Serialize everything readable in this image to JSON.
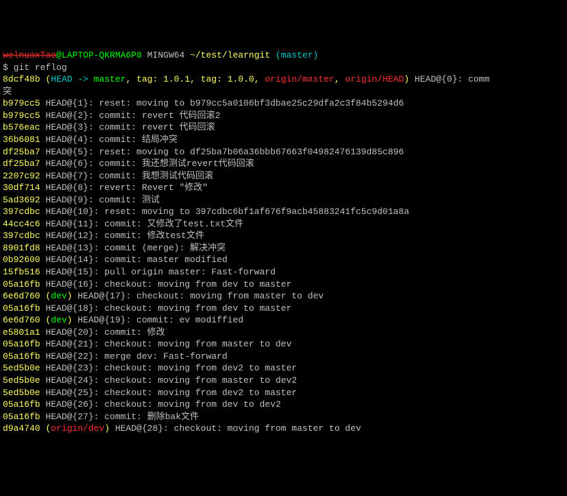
{
  "prompt": {
    "user_redacted": "welnuaxTao",
    "host": "@LAPTOP-QKRMA6P8",
    "shell": " MINGW64",
    "path": " ~/test/learngit",
    "branch": " (master)"
  },
  "command": "$ git reflog",
  "head_line": {
    "hash": "8dcf48b",
    "open": " (",
    "head": "HEAD -> ",
    "master": "master",
    "s1": ", ",
    "tag1": "tag: 1.0.1",
    "s2": ", ",
    "tag2": "tag: 1.0.0",
    "s3": ", ",
    "om": "origin/master",
    "s4": ", ",
    "oh": "origin/HEAD",
    "close": ")",
    "tail": " HEAD@{0}: comm"
  },
  "head_wrap": "突",
  "entries": [
    {
      "hash": "b979cc5",
      "ref": "",
      "text": " HEAD@{1}: reset: moving to b979cc5a0106bf3dbae25c29dfa2c3f84b5294d6"
    },
    {
      "hash": "b979cc5",
      "ref": "",
      "text": " HEAD@{2}: commit: revert 代码回滚2"
    },
    {
      "hash": "b576eac",
      "ref": "",
      "text": " HEAD@{3}: commit: revert 代码回滚"
    },
    {
      "hash": "36b6081",
      "ref": "",
      "text": " HEAD@{4}: commit: 结局冲突"
    },
    {
      "hash": "df25ba7",
      "ref": "",
      "text": " HEAD@{5}: reset: moving to df25ba7b06a36bbb67663f04982476139d85c896"
    },
    {
      "hash": "df25ba7",
      "ref": "",
      "text": " HEAD@{6}: commit: 我还想测试revert代码回滚"
    },
    {
      "hash": "2207c92",
      "ref": "",
      "text": " HEAD@{7}: commit: 我想测试代码回滚"
    },
    {
      "hash": "30df714",
      "ref": "",
      "text": " HEAD@{8}: revert: Revert \"修改\""
    },
    {
      "hash": "5ad3692",
      "ref": "",
      "text": " HEAD@{9}: commit: 测试"
    },
    {
      "hash": "397cdbc",
      "ref": "",
      "text": " HEAD@{10}: reset: moving to 397cdbc6bf1af676f9acb45883241fc5c9d01a8a"
    },
    {
      "hash": "44cc4c6",
      "ref": "",
      "text": " HEAD@{11}: commit: 又修改了test.txt文件"
    },
    {
      "hash": "397cdbc",
      "ref": "",
      "text": " HEAD@{12}: commit: 修改test文件"
    },
    {
      "hash": "8901fd8",
      "ref": "",
      "text": " HEAD@{13}: commit (merge): 解决冲突"
    },
    {
      "hash": "0b92600",
      "ref": "",
      "text": " HEAD@{14}: commit: master modified"
    },
    {
      "hash": "15fb516",
      "ref": "",
      "text": " HEAD@{15}: pull origin master: Fast-forward"
    },
    {
      "hash": "05a16fb",
      "ref": "",
      "text": " HEAD@{16}: checkout: moving from dev to master"
    },
    {
      "hash": "6e6d760",
      "ref": "dev",
      "text": " HEAD@{17}: checkout: moving from master to dev"
    },
    {
      "hash": "05a16fb",
      "ref": "",
      "text": " HEAD@{18}: checkout: moving from dev to master"
    },
    {
      "hash": "6e6d760",
      "ref": "dev",
      "text": " HEAD@{19}: commit: ev modiffied"
    },
    {
      "hash": "e5801a1",
      "ref": "",
      "text": " HEAD@{20}: commit: 修改"
    },
    {
      "hash": "05a16fb",
      "ref": "",
      "text": " HEAD@{21}: checkout: moving from master to dev"
    },
    {
      "hash": "05a16fb",
      "ref": "",
      "text": " HEAD@{22}: merge dev: Fast-forward"
    },
    {
      "hash": "5ed5b0e",
      "ref": "",
      "text": " HEAD@{23}: checkout: moving from dev2 to master"
    },
    {
      "hash": "5ed5b0e",
      "ref": "",
      "text": " HEAD@{24}: checkout: moving from master to dev2"
    },
    {
      "hash": "5ed5b0e",
      "ref": "",
      "text": " HEAD@{25}: checkout: moving from dev2 to master"
    },
    {
      "hash": "05a16fb",
      "ref": "",
      "text": " HEAD@{26}: checkout: moving from dev to dev2"
    },
    {
      "hash": "05a16fb",
      "ref": "",
      "text": " HEAD@{27}: commit: 删除bak文件"
    }
  ],
  "last": {
    "hash": "d9a4740",
    "open": " (",
    "ref": "origin/dev",
    "close": ")",
    "text": " HEAD@{28}: checkout: moving from master to dev"
  }
}
